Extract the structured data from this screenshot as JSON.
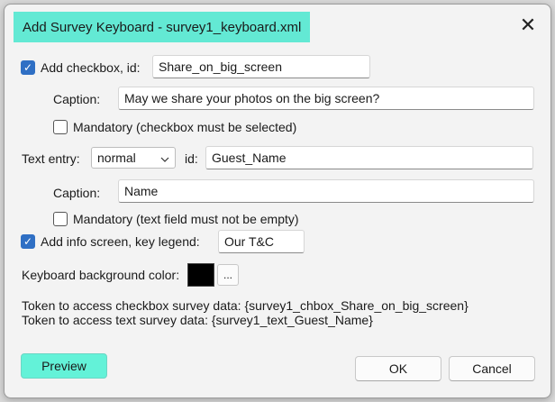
{
  "window": {
    "title": "Add Survey Keyboard - survey1_keyboard.xml",
    "close_glyph": "✕",
    "title_bg": "#63e9d4"
  },
  "checkbox_section": {
    "checked": true,
    "label": "Add checkbox, id:",
    "id_value": "Share_on_big_screen",
    "caption_label": "Caption:",
    "caption_value": "May we share your photos on the big screen?",
    "mandatory_checked": false,
    "mandatory_label": "Mandatory (checkbox must be selected)"
  },
  "text_section": {
    "label": "Text entry:",
    "mode_selected": "normal",
    "dropdown_icon": "chevron-down-icon",
    "id_label": "id:",
    "id_value": "Guest_Name",
    "caption_label": "Caption:",
    "caption_value": "Name",
    "mandatory_checked": false,
    "mandatory_label": "Mandatory (text field must not be empty)"
  },
  "info_section": {
    "checked": true,
    "label": "Add info screen, key legend:",
    "legend_value": "Our T&C"
  },
  "background": {
    "label": "Keyboard background color:",
    "color": "#000000",
    "picker_label": "..."
  },
  "tokens": {
    "checkbox_line": "Token to access checkbox survey data: {survey1_chbox_Share_on_big_screen}",
    "text_line": "Token to access text survey data: {survey1_text_Guest_Name}"
  },
  "buttons": {
    "preview": "Preview",
    "ok": "OK",
    "cancel": "Cancel",
    "preview_color": "#63f2d8"
  },
  "check_glyph": "✓"
}
